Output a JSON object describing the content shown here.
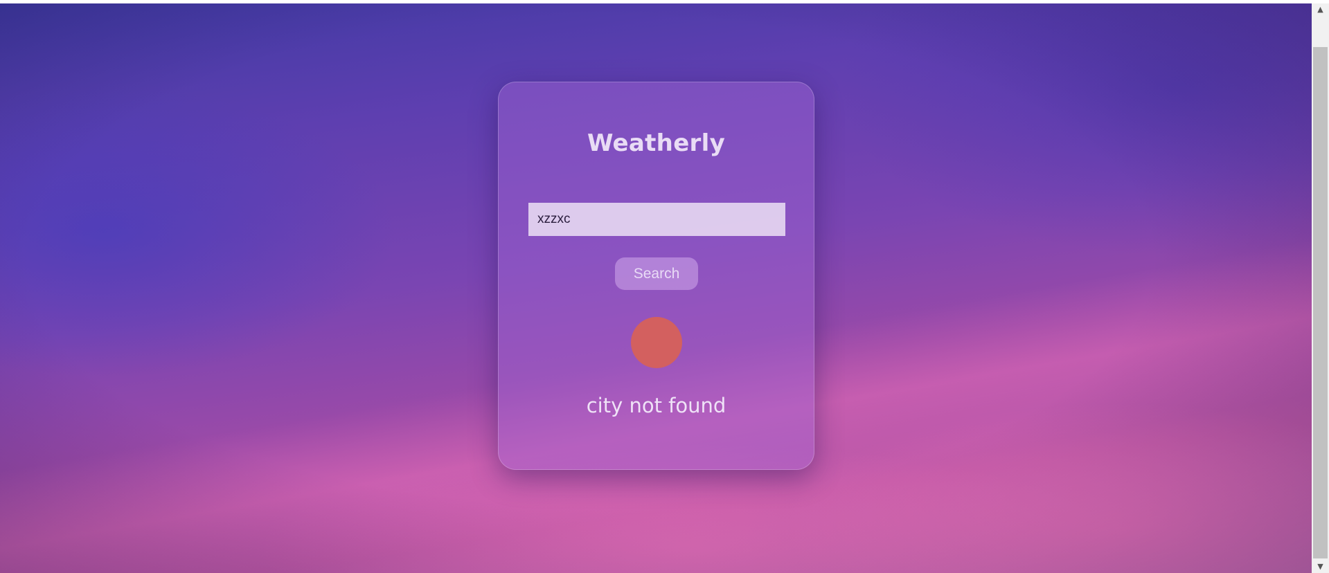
{
  "app": {
    "title": "Weatherly"
  },
  "search": {
    "value": "xzzxc",
    "button_label": "Search"
  },
  "status": {
    "message": "city not found",
    "indicator_color": "#d3605f"
  },
  "scrollbar": {
    "up_glyph": "▲",
    "down_glyph": "▼"
  }
}
